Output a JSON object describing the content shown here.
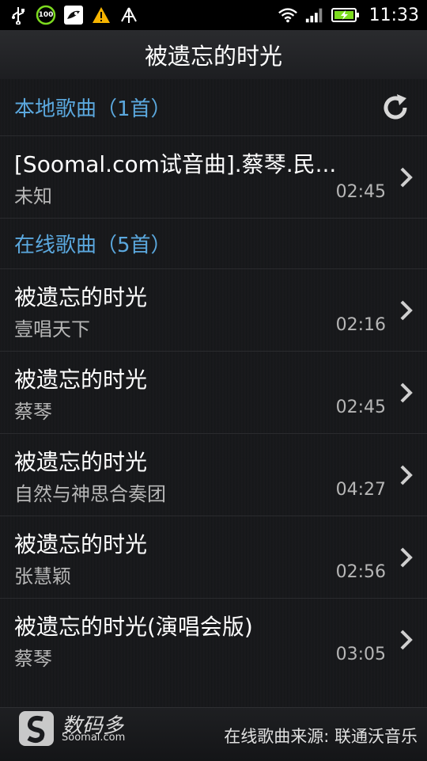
{
  "status_bar": {
    "time": "11:33",
    "battery_badge": "100",
    "icons": [
      "usb-icon",
      "battery-100-icon",
      "app-icon",
      "warning-icon",
      "antenna-icon",
      "wifi-icon",
      "signal-icon",
      "battery-charging-icon"
    ]
  },
  "header": {
    "title": "被遗忘的时光"
  },
  "local_section": {
    "title": "本地歌曲",
    "count": "（1首）",
    "songs": [
      {
        "title": "[Soomal.com试音曲].蔡琴.民...",
        "artist": "未知",
        "duration": "02:45"
      }
    ]
  },
  "online_section": {
    "title": "在线歌曲",
    "count": "（5首）",
    "songs": [
      {
        "title": "被遗忘的时光",
        "artist": "壹唱天下",
        "duration": "02:16"
      },
      {
        "title": "被遗忘的时光",
        "artist": "蔡琴",
        "duration": "02:45"
      },
      {
        "title": "被遗忘的时光",
        "artist": "自然与神思合奏团",
        "duration": "04:27"
      },
      {
        "title": "被遗忘的时光",
        "artist": "张慧颖",
        "duration": "02:56"
      },
      {
        "title": "被遗忘的时光(演唱会版)",
        "artist": "蔡琴",
        "duration": "03:05"
      }
    ]
  },
  "footer": {
    "source": "在线歌曲来源: 联通沃音乐",
    "watermark_cn": "数码多",
    "watermark_en": "Soomal.com"
  },
  "colors": {
    "accent": "#5ba8de",
    "secondary_text": "#b6b6b6"
  }
}
